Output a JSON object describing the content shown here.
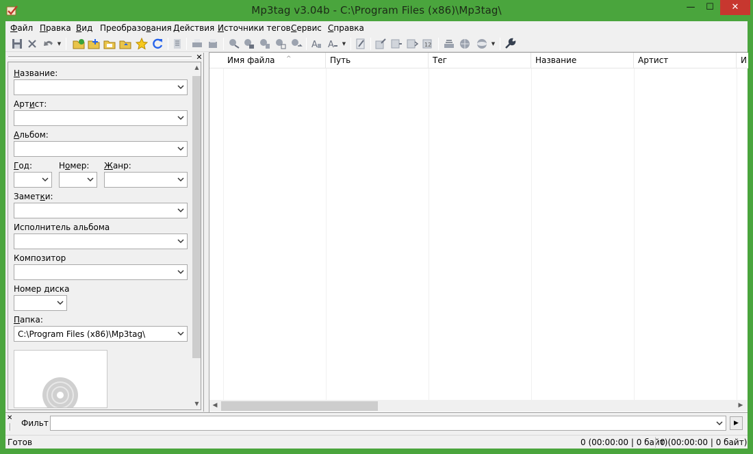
{
  "window": {
    "title": "Mp3tag v3.04b  -  C:\\Program Files (x86)\\Mp3tag\\",
    "minimize_glyph": "—",
    "maximize_glyph": "☐",
    "close_glyph": "✕"
  },
  "menu": {
    "items": [
      {
        "pre": "",
        "u": "Ф",
        "post": "айл"
      },
      {
        "pre": "",
        "u": "П",
        "post": "равка"
      },
      {
        "pre": "",
        "u": "В",
        "post": "ид"
      },
      {
        "pre": "Преобразо",
        "u": "в",
        "post": "ания"
      },
      {
        "pre": "",
        "u": "Д",
        "post": "ействия"
      },
      {
        "pre": "",
        "u": "И",
        "post": "сточники тегов"
      },
      {
        "pre": "",
        "u": "С",
        "post": "ервис"
      },
      {
        "pre": "",
        "u": "С",
        "post": "правка"
      }
    ]
  },
  "toolbar": {
    "icons": [
      "save-icon",
      "remove-tag-icon",
      "undo-icon",
      "change-directory-icon",
      "add-directory-icon",
      "open-playlist-icon",
      "favorites-icon",
      "refresh-icon",
      "extended-tags-icon",
      "print-icon",
      "copy-icon",
      "tag-file-icon",
      "filename-tag-icon",
      "text-tag-icon",
      "tag-tag-icon",
      "case-icon",
      "actions-icon",
      "export-icon",
      "freedb-icon",
      "tag-sources-icon",
      "options-icon"
    ]
  },
  "tag_panel": {
    "close_glyph": "✕",
    "fields": {
      "title": {
        "pre": "",
        "u": "Н",
        "post": "азвание:",
        "value": ""
      },
      "artist": {
        "pre": "Арт",
        "u": "и",
        "post": "ст:",
        "value": ""
      },
      "album": {
        "pre": "",
        "u": "А",
        "post": "льбом:",
        "value": ""
      },
      "year": {
        "pre": "",
        "u": "Г",
        "post": "од:",
        "value": ""
      },
      "track": {
        "pre": "Н",
        "u": "о",
        "post": "мер:",
        "value": ""
      },
      "genre": {
        "pre": "",
        "u": "Ж",
        "post": "анр:",
        "value": ""
      },
      "comment": {
        "pre": "Замет",
        "u": "к",
        "post": "и:",
        "value": ""
      },
      "album_artist": {
        "pre": "",
        "u": "",
        "post": "Исполнитель альбома",
        "value": ""
      },
      "composer": {
        "pre": "",
        "u": "",
        "post": "Композитор",
        "value": ""
      },
      "discnumber": {
        "pre": "",
        "u": "",
        "post": "Номер диска",
        "value": ""
      },
      "directory": {
        "pre": "",
        "u": "П",
        "post": "апка:",
        "value": "C:\\Program Files (x86)\\Mp3tag\\"
      }
    }
  },
  "file_list": {
    "columns": [
      "Имя файла",
      "Путь",
      "Тег",
      "Название",
      "Артист",
      "И"
    ],
    "sorted_column": 0,
    "rows": []
  },
  "filter": {
    "label": "Фильтр",
    "value": "",
    "go_glyph": "▶"
  },
  "status": {
    "text": "Готов",
    "selected": "0 (00:00:00 | 0 байт)",
    "total": "0 (00:00:00 | 0 байт)"
  },
  "colors": {
    "accent": "#4aa53d",
    "close_button": "#c7372f",
    "face": "#f0f0f0"
  }
}
